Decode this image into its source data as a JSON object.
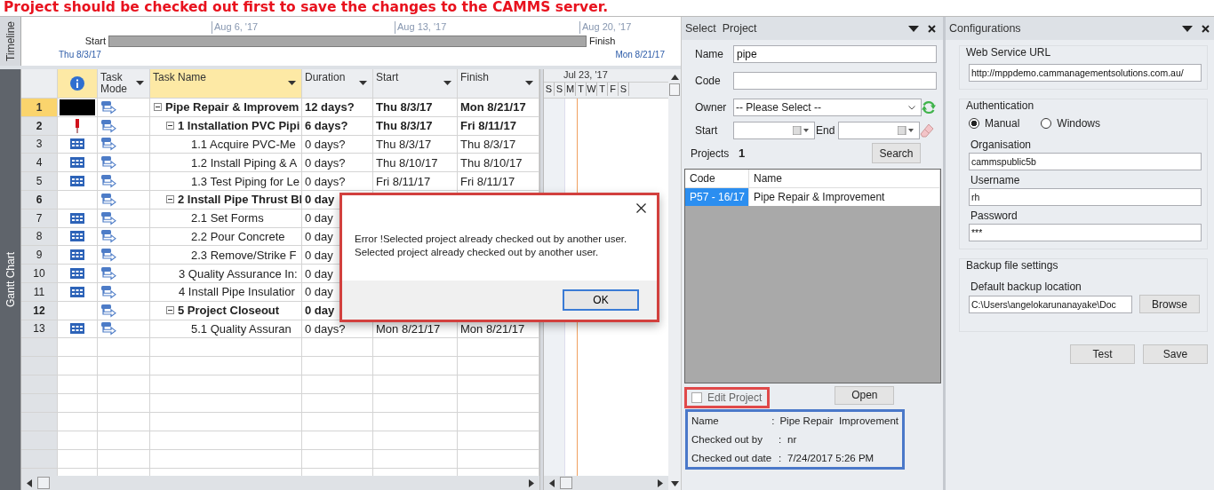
{
  "banner": "Project should be checked out first to save the changes to the CAMMS server.",
  "timeline": {
    "label": "Timeline",
    "start_label": "Start",
    "start_date": "Thu 8/3/17",
    "finish_label": "Finish",
    "finish_date": "Mon 8/21/17",
    "ticks": [
      "Aug 6, '17",
      "Aug 13, '17",
      "Aug 20, '17"
    ]
  },
  "gantt": {
    "label": "Gantt Chart",
    "columns": [
      {
        "kind": "info",
        "selected": true
      },
      {
        "label": "Task Mode",
        "selected": false
      },
      {
        "label": "Task Name",
        "selected": true
      },
      {
        "label": "Duration",
        "selected": false
      },
      {
        "label": "Start",
        "selected": false
      },
      {
        "label": "Finish",
        "selected": false
      }
    ],
    "chart_header": {
      "month": "Jul 23, '17",
      "days": [
        "S",
        "S",
        "M",
        "T",
        "W",
        "T",
        "F",
        "S"
      ]
    },
    "tasks": [
      {
        "id": "1",
        "selected": true,
        "kind": "redacted",
        "summary": true,
        "expanded": true,
        "name": "Pipe Repair & Improvem",
        "duration": "12 days?",
        "start": "Thu 8/3/17",
        "finish": "Mon 8/21/17",
        "children": [
          {
            "id": "2",
            "selected": false,
            "kind": "pin",
            "summary": true,
            "expanded": true,
            "name": "1 Installation PVC Pipi",
            "duration": "6 days?",
            "start": "Thu 8/3/17",
            "finish": "Fri 8/11/17",
            "children": [
              {
                "id": "3",
                "selected": false,
                "kind": "calendar",
                "summary": false,
                "name": "1.1 Acquire PVC-Me",
                "duration": "0 days?",
                "start": "Thu 8/3/17",
                "finish": "Thu 8/3/17"
              },
              {
                "id": "4",
                "selected": false,
                "kind": "calendar",
                "summary": false,
                "name": "1.2 Install Piping & A",
                "duration": "0 days?",
                "start": "Thu 8/10/17",
                "finish": "Thu 8/10/17"
              },
              {
                "id": "5",
                "selected": false,
                "kind": "calendar",
                "summary": false,
                "name": "1.3 Test Piping for Le",
                "duration": "0 days?",
                "start": "Fri 8/11/17",
                "finish": "Fri 8/11/17"
              }
            ]
          },
          {
            "id": "6",
            "selected": false,
            "summary": true,
            "expanded": true,
            "name": "2 Install Pipe Thrust Bl",
            "duration": "0 day",
            "children": [
              {
                "id": "7",
                "selected": false,
                "kind": "calendar",
                "summary": false,
                "name": "2.1 Set Forms",
                "duration": "0 day"
              },
              {
                "id": "8",
                "selected": false,
                "kind": "calendar",
                "summary": false,
                "name": "2.2 Pour Concrete",
                "duration": "0 day"
              },
              {
                "id": "9",
                "selected": false,
                "kind": "calendar",
                "summary": false,
                "name": "2.3 Remove/Strike F",
                "duration": "0 day"
              }
            ]
          },
          {
            "id": "10",
            "selected": false,
            "kind": "calendar",
            "summary": false,
            "name": "3 Quality Assurance In:",
            "duration": "0 day"
          },
          {
            "id": "11",
            "selected": false,
            "kind": "calendar",
            "summary": false,
            "name": "4 Install Pipe Insulatior",
            "duration": "0 day"
          },
          {
            "id": "12",
            "selected": false,
            "summary": true,
            "expanded": true,
            "name": "5 Project Closeout",
            "duration": "0 day",
            "children": [
              {
                "id": "13",
                "selected": false,
                "kind": "calendar",
                "summary": false,
                "name": "5.1 Quality Assuran",
                "duration": "0 days?",
                "start": "Mon 8/21/17",
                "finish": "Mon 8/21/17"
              }
            ]
          }
        ]
      }
    ]
  },
  "dialog": {
    "lines": [
      "Error !Selected project already checked out by another user.",
      "Selected project already checked out by another user."
    ],
    "ok": "OK"
  },
  "select_project": {
    "title": "Select  Project",
    "name": {
      "label": "Name",
      "value": "pipe"
    },
    "code": {
      "label": "Code"
    },
    "owner": {
      "label": "Owner",
      "value": "-- Please Select --"
    },
    "start": {
      "label": "Start"
    },
    "end": {
      "label": "End"
    },
    "projects_label": "Projects",
    "projects_count": "1",
    "search": "Search",
    "table": {
      "columns": [
        "Code",
        "Name"
      ],
      "rows": [
        {
          "code": "P57 - 16/17",
          "name": "Pipe Repair & Improvement",
          "selected": true
        }
      ]
    },
    "edit_project": {
      "label": "Edit Project",
      "checked": false
    },
    "open": "Open",
    "info": [
      {
        "label": "Name",
        "separator": ":",
        "value": "Pipe Repair  Improvement"
      },
      {
        "label": "Checked out by",
        "separator": ":",
        "value": "nr"
      },
      {
        "label": "Checked out date",
        "separator": ":",
        "value": "7/24/2017 5:26 PM"
      }
    ]
  },
  "configurations": {
    "title": "Configurations",
    "web_service": {
      "legend": "Web Service URL",
      "value": "http://mppdemo.cammanagementsolutions.com.au/"
    },
    "authentication": {
      "legend": "Authentication",
      "modes": [
        {
          "label": "Manual",
          "selected": true
        },
        {
          "label": "Windows",
          "selected": false
        }
      ],
      "fields": [
        {
          "label": "Organisation",
          "value": "cammspublic5b"
        },
        {
          "label": "Username",
          "value": "rh"
        },
        {
          "label": "Password",
          "value": "***"
        }
      ]
    },
    "backup": {
      "legend": "Backup file settings",
      "label": "Default backup location",
      "value": "C:\\Users\\angelokarunanayake\\Doc",
      "browse": "Browse"
    },
    "buttons": [
      "Test",
      "Save"
    ]
  }
}
